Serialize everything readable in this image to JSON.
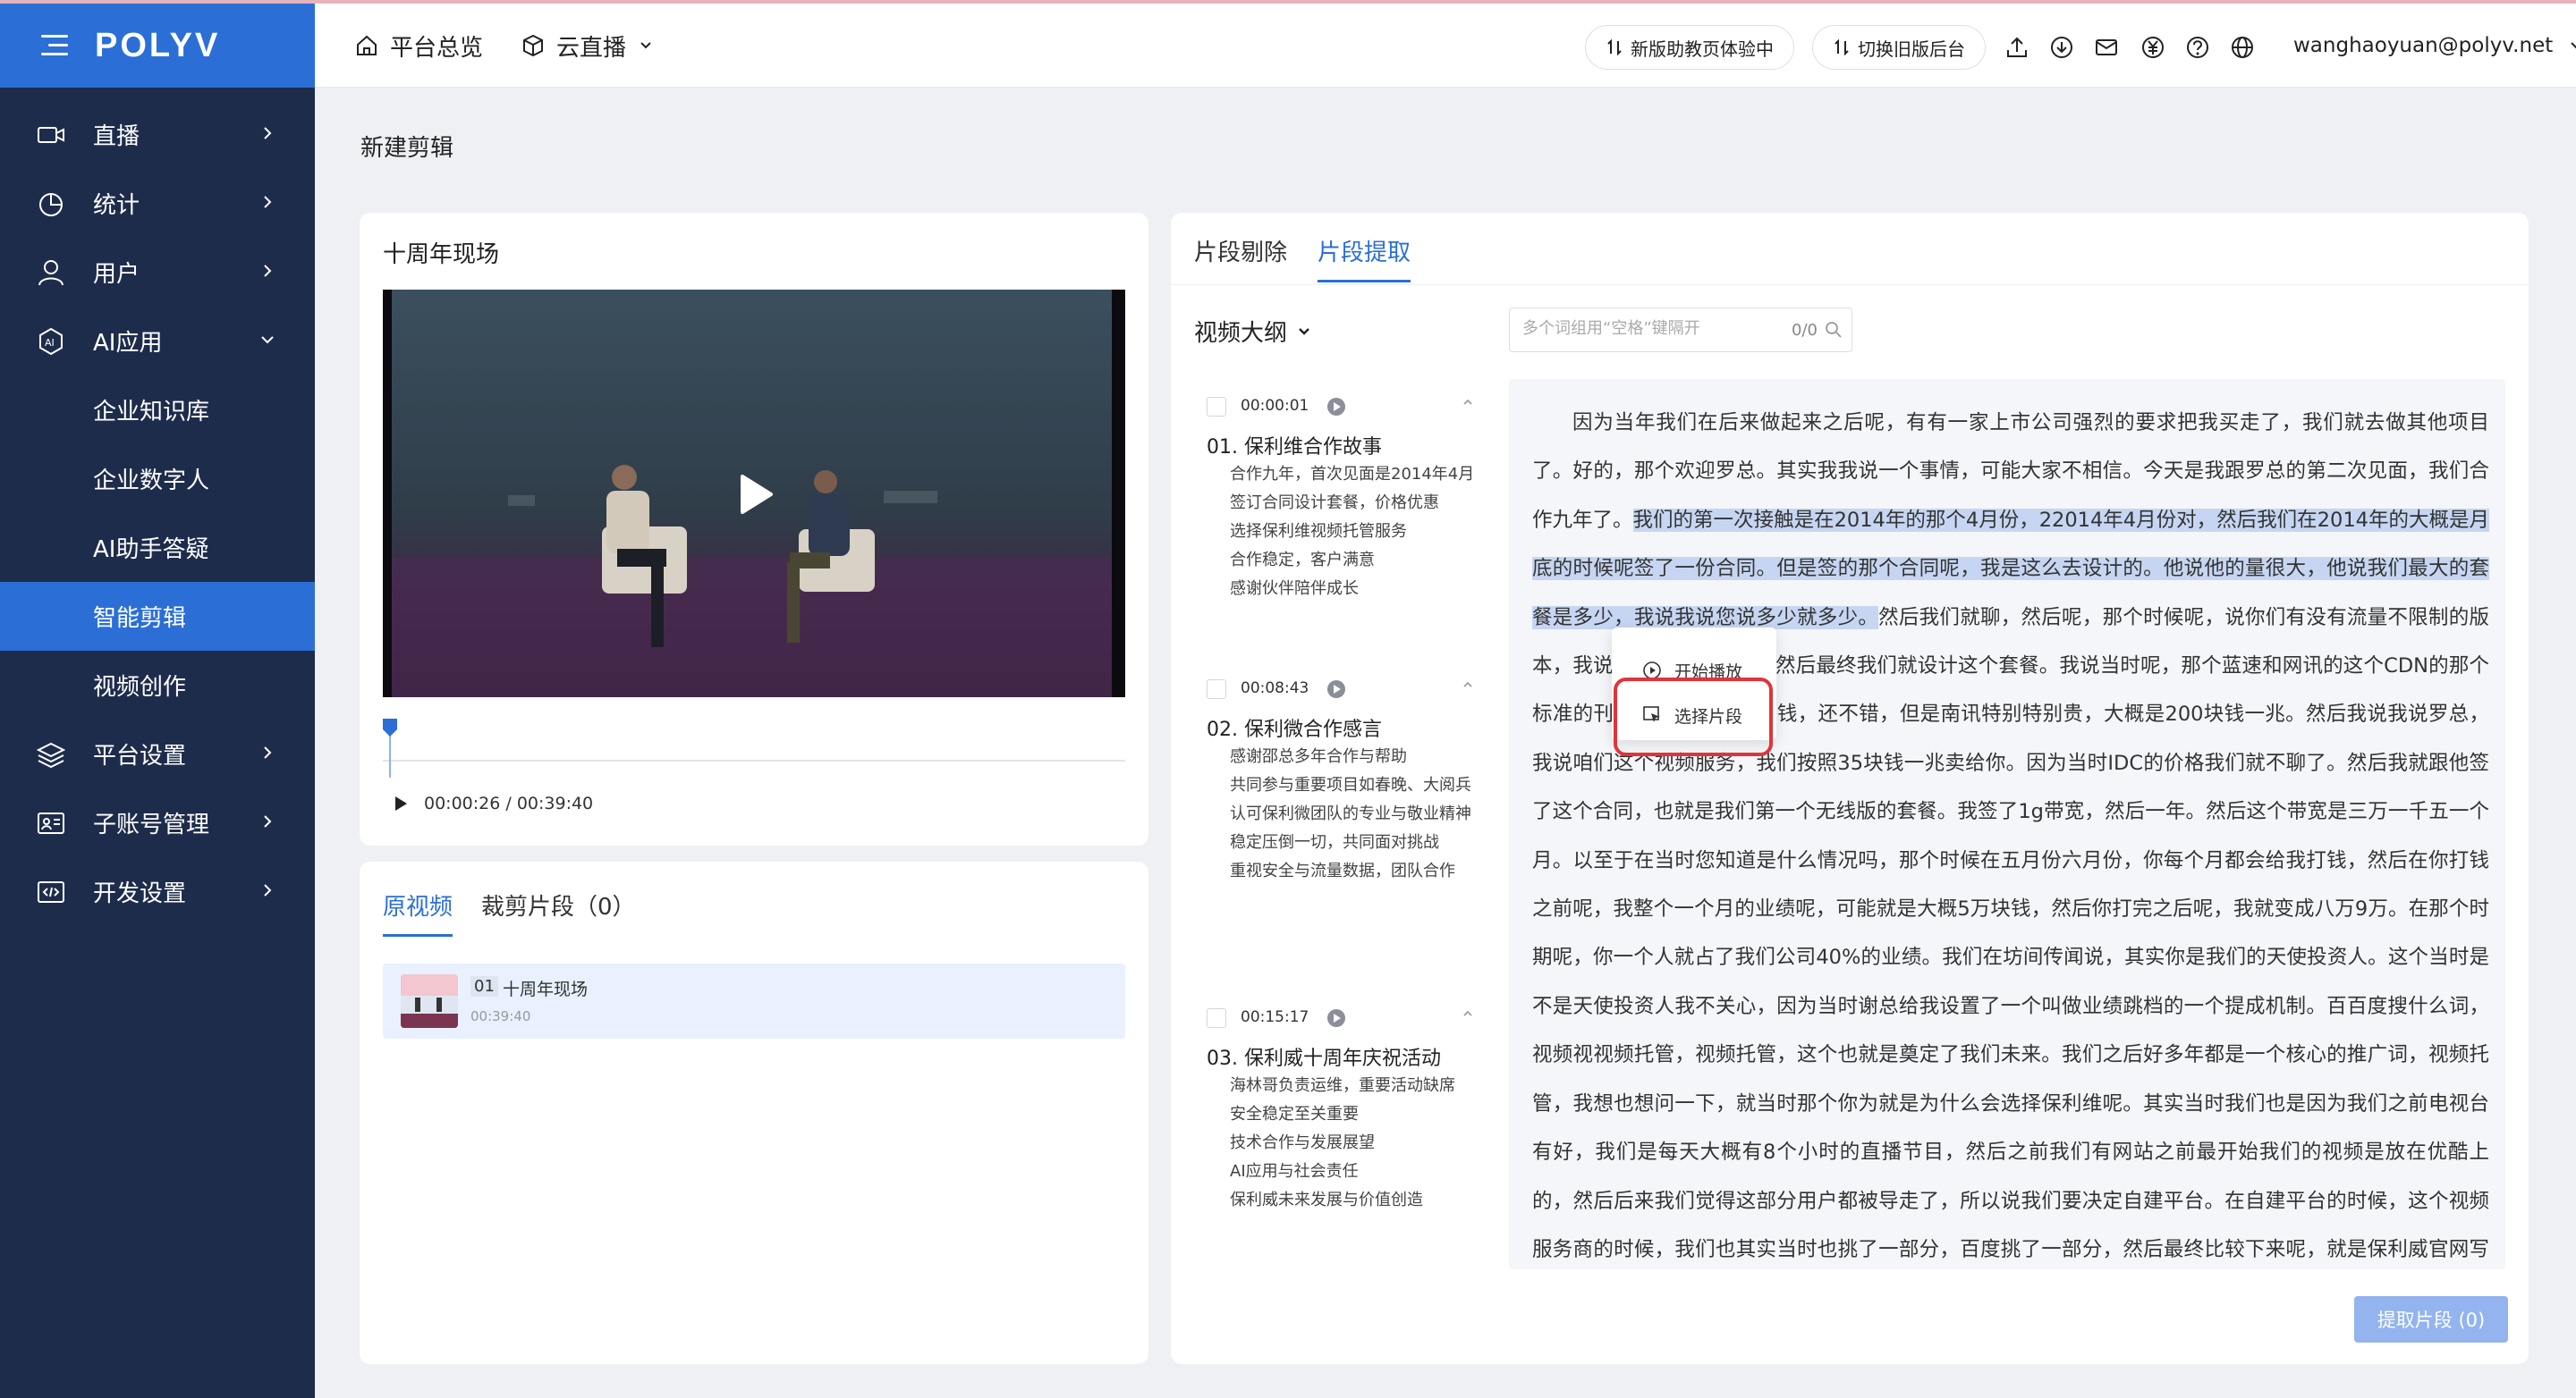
{
  "app": {
    "logo": "POLYV"
  },
  "sidebar": {
    "items": [
      {
        "label": "直播",
        "icon": "video-camera-icon"
      },
      {
        "label": "统计",
        "icon": "pie-chart-icon"
      },
      {
        "label": "用户",
        "icon": "user-icon"
      },
      {
        "label": "AI应用",
        "icon": "ai-icon"
      },
      {
        "label": "企业知识库"
      },
      {
        "label": "企业数字人"
      },
      {
        "label": "AI助手答疑"
      },
      {
        "label": "智能剪辑"
      },
      {
        "label": "视频创作"
      },
      {
        "label": "平台设置",
        "icon": "layers-icon"
      },
      {
        "label": "子账号管理",
        "icon": "id-card-icon"
      },
      {
        "label": "开发设置",
        "icon": "code-icon"
      }
    ]
  },
  "header": {
    "home": "平台总览",
    "product": "云直播",
    "new_version": "新版助教页体验中",
    "switch_old": "切换旧版后台",
    "user": "wanghaoyuan@polyv.net"
  },
  "page": {
    "title": "新建剪辑"
  },
  "video": {
    "title": "十周年现场",
    "time": "00:00:26 / 00:39:40",
    "progress": 0.011
  },
  "clips": {
    "tab_original": "原视频",
    "tab_clipped": "裁剪片段（0）",
    "item": {
      "index": "01",
      "name": "十周年现场",
      "duration": "00:39:40"
    }
  },
  "editor": {
    "tab_remove": "片段剔除",
    "tab_extract": "片段提取",
    "outline_title": "视频大纲",
    "search": {
      "placeholder": "多个词组用“空格”键隔开",
      "count": "0/0"
    },
    "extract_button": "提取片段 (0)"
  },
  "chapters": [
    {
      "time": "00:00:01",
      "title": "01. 保利维合作故事",
      "points": [
        "合作九年，首次见面是2014年4月",
        "签订合同设计套餐，价格优惠",
        "选择保利维视频托管服务",
        "合作稳定，客户满意",
        "感谢伙伴陪伴成长"
      ]
    },
    {
      "time": "00:08:43",
      "title": "02. 保利微合作感言",
      "points": [
        "感谢邵总多年合作与帮助",
        "共同参与重要项目如春晚、大阅兵",
        "认可保利微团队的专业与敬业精神",
        "稳定压倒一切，共同面对挑战",
        "重视安全与流量数据，团队合作"
      ]
    },
    {
      "time": "00:15:17",
      "title": "03. 保利威十周年庆祝活动",
      "points": [
        "海林哥负责运维，重要活动缺席",
        "安全稳定至关重要",
        "技术合作与发展展望",
        "AI应用与社会责任",
        "保利威未来发展与价值创造"
      ]
    }
  ],
  "transcript": {
    "before": "因为当年我们在后来做起来之后呢，有有一家上市公司强烈的要求把我买走了，我们就去做其他项目了。好的，那个欢迎罗总。其实我我说一个事情，可能大家不相信。今天是我跟罗总的第二次见面，我们合作九年了。",
    "highlight": "我们的第一次接触是在2014年的那个4月份，22014年4月份对，然后我们在2014年的大概是月底的时候呢签了一份合同。但是签的那个合同呢，我是这么去设计的。他说他的量很大，他说我们最大的套餐是多少，我说我说您说多少就多少。",
    "after": "然后我们就聊，然后呢，那个时候呢，说你们有没有流量不限制的版本，我说有，我们就谈了，然后最终我们就设计这个套餐。我说当时呢，那个蓝速和网讯的这个CDN的那个标准的刊例价呢，是一块多钱，还不错，但是南讯特别特别贵，大概是200块钱一兆。然后我说我说罗总，我说咱们这个视频服务，我们按照35块钱一兆卖给你。因为当时IDC的价格我们就不聊了。然后我就跟他签了这个合同，也就是我们第一个无线版的套餐。我签了1g带宽，然后一年。然后这个带宽是三万一千五一个月。以至于在当时您知道是什么情况吗，那个时候在五月份六月份，你每个月都会给我打钱，然后在你打钱之前呢，我整个一个月的业绩呢，可能就是大概5万块钱，然后你打完之后呢，我就变成八万9万。在那个时期呢，你一个人就占了我们公司40%的业绩。我们在坊间传闻说，其实你是我们的天使投资人。这个当时是不是天使投资人我不关心，因为当时谢总给我设置了一个叫做业绩跳档的一个提成机制。百百度搜什么词，视频视视频托管，视频托管，这个也就是奠定了我们未来。我们之后好多年都是一个核心的推广词，视频托管，我想也想问一下，就当时那个你为就是为什么会选择保利维呢。其实当时我们也是因为我们之前电视台有好，我们是每天大概有8个小时的直播节目，然后之前我们有网站之前最开始我们的视频是放在优酷上的，然后后来我们觉得这部分用户都被导走了，所以说我们要决定自建平台。在自建平台的时候，这个视频服务商的时候，我们也其实当时也挑了一部分，百度挑了一部分，然后最终比较下来呢，就是保利威官网写的最"
  },
  "context_menu": {
    "start_play": "开始播放",
    "select_segment": "选择片段"
  },
  "colors": {
    "accent": "#2b6fd6",
    "sidebar_bg": "#1e2c4c",
    "highlight": "#c6d6f2",
    "alert": "#e0343a"
  }
}
